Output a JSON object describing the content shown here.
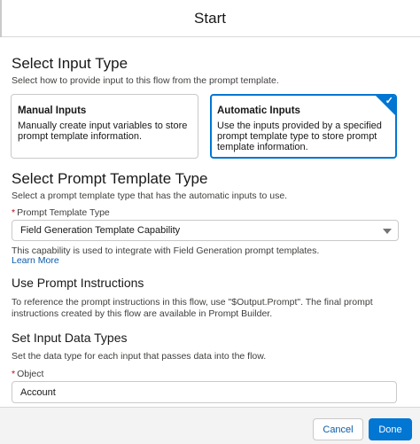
{
  "modal": {
    "title": "Start"
  },
  "input_type": {
    "heading": "Select Input Type",
    "description": "Select how to provide input to this flow from the prompt template.",
    "options": [
      {
        "title": "Manual Inputs",
        "description": "Manually create input variables to store prompt template information.",
        "selected": false
      },
      {
        "title": "Automatic Inputs",
        "description": "Use the inputs provided by a specified prompt template type to store prompt template information.",
        "selected": true
      }
    ]
  },
  "prompt_template_type": {
    "heading": "Select Prompt Template Type",
    "description": "Select a prompt template type that has the automatic inputs to use.",
    "required_mark": "*",
    "field_label": "Prompt Template Type",
    "selected_value": "Field Generation Template Capability",
    "help_text": "This capability is used to integrate with Field Generation prompt templates.",
    "learn_more": "Learn More"
  },
  "prompt_instructions": {
    "heading": "Use Prompt Instructions",
    "description": "To reference the prompt instructions in this flow, use \"$Output.Prompt\". The final prompt instructions created by this flow are available in Prompt Builder."
  },
  "input_data_types": {
    "heading": "Set Input Data Types",
    "description": "Set the data type for each input that passes data into the flow.",
    "required_mark": "*",
    "object_label": "Object",
    "object_value": "Account"
  },
  "footer": {
    "cancel_label": "Cancel",
    "done_label": "Done"
  },
  "colors": {
    "brand": "#0176d3",
    "link": "#0b5cab",
    "required": "#ba0517"
  },
  "icons": {
    "selected_check": "checkmark-icon",
    "select_caret": "chevron-down-icon"
  }
}
